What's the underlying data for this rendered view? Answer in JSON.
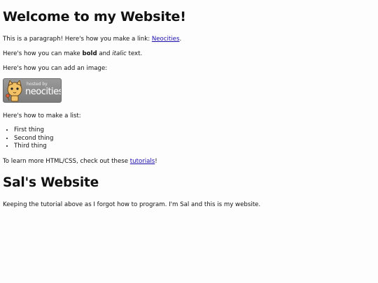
{
  "heading_main": "Welcome to my Website!",
  "paragraph_link": {
    "before": "This is a paragraph! Here's how you make a link: ",
    "link_text": "Neocities",
    "after": "."
  },
  "paragraph_format": {
    "before": "Here's how you can make ",
    "bold": "bold",
    "middle": " and ",
    "italic": "italic",
    "after": " text."
  },
  "paragraph_image": "Here's how you can add an image:",
  "badge": {
    "hosted_text": "hosted by",
    "name_text": "neocities"
  },
  "paragraph_list": "Here's how to make a list:",
  "list_items": [
    "First thing",
    "Second thing",
    "Third thing"
  ],
  "paragraph_learn": {
    "before": "To learn more HTML/CSS, check out these ",
    "link_text": "tutorials",
    "after": "!"
  },
  "heading_sal": "Sal's Website",
  "paragraph_sal": "Keeping the tutorial above as I forgot how to program. I'm Sal and this is my website.",
  "colors": {
    "link": "#1a0dab",
    "text": "#111111",
    "background": "#fdfdfd"
  }
}
